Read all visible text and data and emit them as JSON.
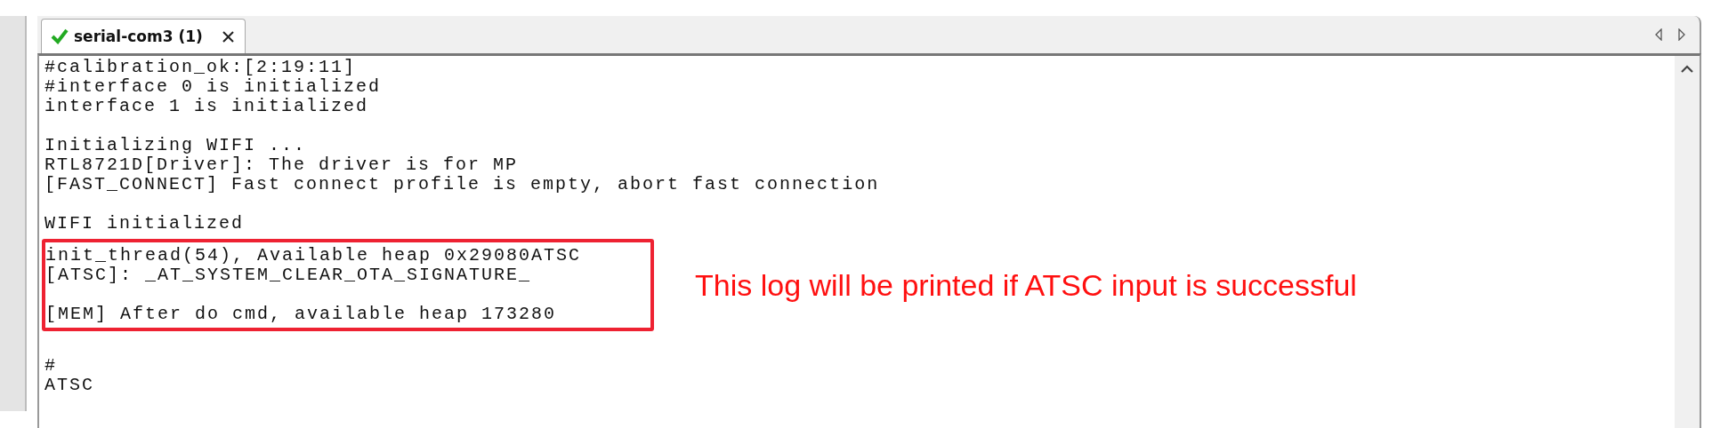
{
  "tab": {
    "label": "serial-com3 (1)"
  },
  "log": {
    "before": [
      {
        "kind": "text",
        "text": "#calibration_ok:[2:19:11]"
      },
      {
        "kind": "text",
        "text": "#interface 0 is initialized"
      },
      {
        "kind": "text",
        "text": "interface 1 is initialized"
      },
      {
        "kind": "blank"
      },
      {
        "kind": "text",
        "text": "Initializing WIFI ..."
      },
      {
        "kind": "text",
        "text": "RTL8721D[Driver]: The driver is for MP"
      },
      {
        "kind": "text",
        "text": "[FAST_CONNECT] Fast connect profile is empty, abort fast connection"
      },
      {
        "kind": "blank"
      },
      {
        "kind": "text",
        "text": "WIFI initialized"
      }
    ],
    "highlighted": {
      "lines": [
        {
          "kind": "text",
          "text": "init_thread(54), Available heap 0x29080ATSC"
        },
        {
          "kind": "text",
          "text": "[ATSC]: _AT_SYSTEM_CLEAR_OTA_SIGNATURE_"
        },
        {
          "kind": "blank"
        },
        {
          "kind": "text",
          "text": "[MEM] After do cmd, available heap 173280"
        }
      ],
      "note": "This log will be printed if ATSC input is successful"
    },
    "after": [
      {
        "kind": "blank"
      },
      {
        "kind": "text",
        "text": "#"
      },
      {
        "kind": "text",
        "text": "ATSC"
      }
    ]
  }
}
